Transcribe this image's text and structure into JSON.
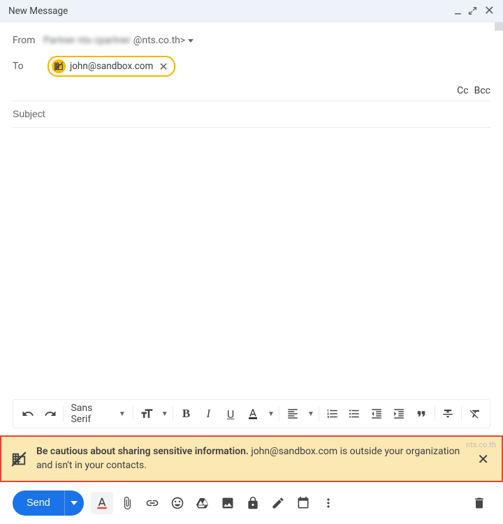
{
  "header": {
    "title": "New Message"
  },
  "from": {
    "label": "From",
    "blurred_name": "Partner nts  cpartner",
    "domain_part": "@nts.co.th>"
  },
  "to": {
    "label": "To",
    "chip_email": "john@sandbox.com"
  },
  "ccbcc": {
    "cc": "Cc",
    "bcc": "Bcc"
  },
  "subject": {
    "placeholder": "Subject"
  },
  "format_toolbar": {
    "font_family": "Sans Serif"
  },
  "warning": {
    "bold": "Be cautious about sharing sensitive information.",
    "rest": " john@sandbox.com is outside your organization and isn't in your contacts."
  },
  "bottom": {
    "send": "Send"
  },
  "footer_domain": "nts.co.th"
}
